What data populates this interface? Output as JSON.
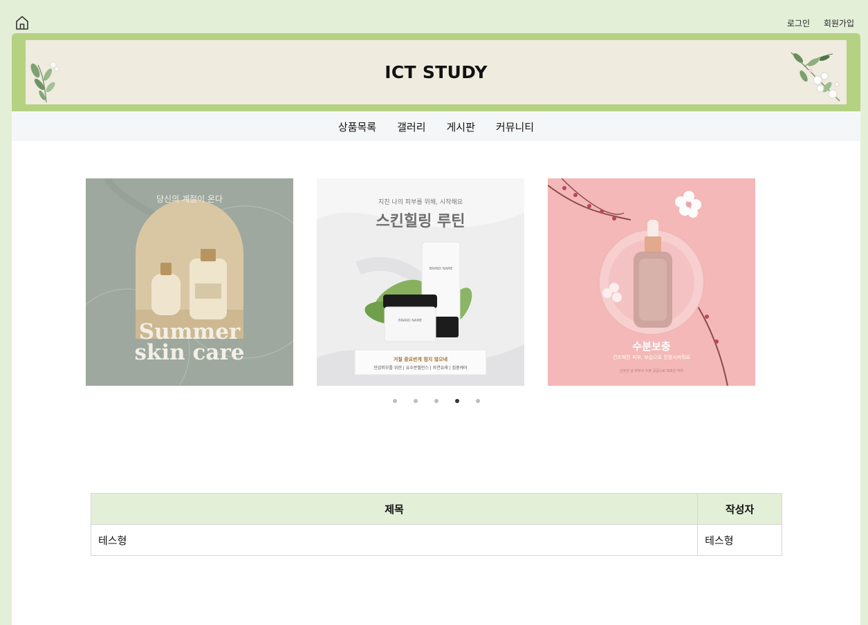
{
  "topbar": {
    "home_icon": "home-icon",
    "login": "로그인",
    "signup": "회원가입"
  },
  "header": {
    "title": "ICT STUDY",
    "decor_left": "leaf-branch-illustration",
    "decor_right": "flower-branch-illustration"
  },
  "nav": {
    "items": [
      "상품목록",
      "갤러리",
      "게시판",
      "커뮤니티"
    ]
  },
  "slider": {
    "slides": [
      {
        "name": "summer-skin-care",
        "background": "#9ea89e",
        "caption_top": "당신의 계절이 온다",
        "caption_line1": "Summer",
        "caption_line2": "skin care"
      },
      {
        "name": "skin-healing-routine",
        "background": "#eeeeef",
        "script_top": "지친 나의 피부를 위해, 시작해요",
        "headline": "스킨힐링 루틴",
        "brand_label_tube": "BRAND NAME",
        "brand_label_jar": "BRAND NAME",
        "box_line1": "거칠 증요반게 멈지 않으네",
        "box_line2": "민감피부를 위한 | 유수분밸런스 | 자연유래 | 집중케어"
      },
      {
        "name": "moisture-care",
        "background": "#f3b8b7",
        "headline": "수분보충",
        "subline": "건조해진 피부, 보습으로 진정시켜줘요",
        "footnote": "건조한 날 피부의 수분 공급으로 촉촉한 하루"
      }
    ],
    "dot_count": 5,
    "active_index": 3
  },
  "board": {
    "headers": {
      "title": "제목",
      "writer": "작성자"
    },
    "rows": [
      {
        "title": "테스형",
        "writer": "테스형"
      }
    ]
  },
  "colors": {
    "page_bg": "#e4efd8",
    "banner_border": "#b5d182",
    "banner_bg": "#efebde",
    "nav_bg": "#f4f7f7",
    "table_header_bg": "#e4efd8"
  }
}
